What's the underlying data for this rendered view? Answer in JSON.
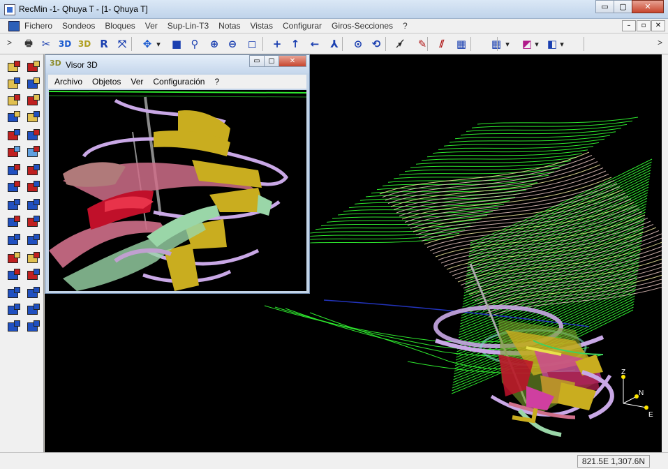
{
  "window": {
    "title": "RecMin -1- Qhuya T - [1- Qhuya T]",
    "caption_buttons": {
      "minimize": "▭",
      "maximize": "▢",
      "close": "✕"
    }
  },
  "menubar": {
    "items": [
      "Fichero",
      "Sondeos",
      "Bloques",
      "Ver",
      "Sup-Lin-T3",
      "Notas",
      "Vistas",
      "Configurar",
      "Giros-Secciones",
      "?"
    ],
    "mdi_buttons": {
      "minimize": "–",
      "restore": "▫",
      "close": "✕"
    }
  },
  "toolbar": {
    "buttons": [
      {
        "name": "printer-icon",
        "glyph": "🖶"
      },
      {
        "name": "scissors-icon",
        "glyph": "✂"
      },
      {
        "name": "3d-view-icon",
        "glyph": "3D"
      },
      {
        "name": "3d-render-icon",
        "glyph": "3D"
      },
      {
        "name": "reset-icon",
        "glyph": "R"
      },
      {
        "name": "fit-window-icon",
        "glyph": "⤧"
      },
      {
        "name": "pan-icon",
        "glyph": "✥"
      },
      {
        "name": "rectangle-select-icon",
        "glyph": "■"
      },
      {
        "name": "zoom-icon",
        "glyph": "⚲"
      },
      {
        "name": "zoom-in-icon",
        "glyph": "⊕"
      },
      {
        "name": "zoom-out-icon",
        "glyph": "⊖"
      },
      {
        "name": "zoom-window-icon",
        "glyph": "◻"
      },
      {
        "name": "cross-icon",
        "glyph": "+"
      },
      {
        "name": "arrow-up-icon",
        "glyph": "↑"
      },
      {
        "name": "arrow-left-icon",
        "glyph": "←"
      },
      {
        "name": "axes-icon",
        "glyph": "⅄"
      },
      {
        "name": "target-icon",
        "glyph": "⊙"
      },
      {
        "name": "rotate-icon",
        "glyph": "⟲"
      },
      {
        "name": "measure-icon",
        "glyph": "⟋"
      },
      {
        "name": "pencil-icon",
        "glyph": "✎"
      },
      {
        "name": "edit-lines-icon",
        "glyph": "⫽"
      },
      {
        "name": "calculator-icon",
        "glyph": "▦"
      },
      {
        "name": "grid-icon",
        "glyph": "▦"
      },
      {
        "name": "color-scale-icon",
        "glyph": "◩"
      },
      {
        "name": "panels-icon",
        "glyph": "◧"
      }
    ],
    "dropdown_glyph": "▾"
  },
  "visor": {
    "title": "Visor 3D",
    "icon_text": "3D",
    "menu": [
      "Archivo",
      "Objetos",
      "Ver",
      "Configuración",
      "?"
    ]
  },
  "axes": {
    "z": "Z",
    "n": "N",
    "e": "E"
  },
  "status": {
    "coordinates": "821.5E 1,307.6N"
  },
  "colors": {
    "topo_green": "#2ee82e",
    "topo_pink": "#e9c6c2",
    "topo_yellow": "#f2e9a0",
    "ore_yellow": "#c9ad1f",
    "ore_red": "#c0102a",
    "ore_pink": "#cf6f8a",
    "ore_mint": "#9ad6a8",
    "tunnel_lilac": "#c9a8e6"
  }
}
